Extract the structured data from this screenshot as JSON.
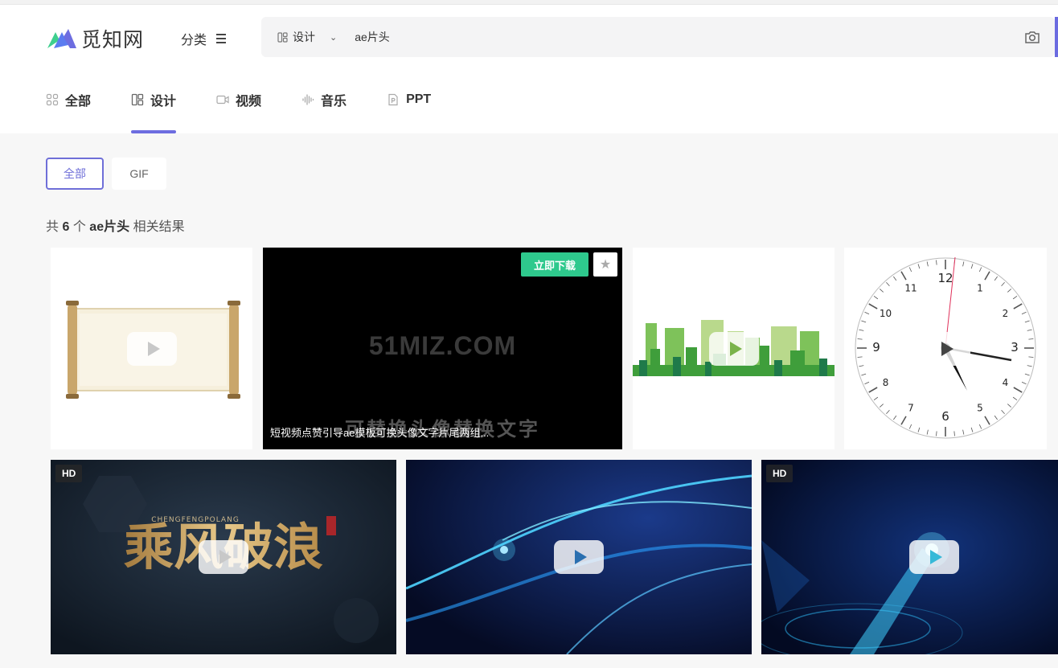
{
  "brand": {
    "name": "觅知网",
    "accent": "#6d6de0",
    "green": "#2ec98d"
  },
  "header": {
    "category_label": "分类"
  },
  "search": {
    "type_label": "设计",
    "query": "ae片头",
    "placeholder": ""
  },
  "tabs": [
    {
      "label": "全部",
      "icon": "grid-icon"
    },
    {
      "label": "设计",
      "icon": "layout-icon",
      "active": true
    },
    {
      "label": "视频",
      "icon": "video-icon"
    },
    {
      "label": "音乐",
      "icon": "audio-wave-icon"
    },
    {
      "label": "PPT",
      "icon": "ppt-file-icon"
    }
  ],
  "filters": [
    {
      "label": "全部",
      "active": true
    },
    {
      "label": "GIF"
    }
  ],
  "results": {
    "prefix": "共",
    "count": "6",
    "measure": "个",
    "keyword": "ae片头",
    "suffix": "相关结果"
  },
  "cards": [
    {
      "id": "scroll"
    },
    {
      "id": "51miz",
      "watermark": "51MIZ.COM",
      "overlay_text": "可替换头像替换文字",
      "title": "短视频点赞引导ae模板可换头像文字片尾两组...",
      "download_label": "立即下载"
    },
    {
      "id": "city"
    },
    {
      "id": "clock",
      "numbers": [
        "12",
        "1",
        "2",
        "3",
        "4",
        "5",
        "6",
        "7",
        "8",
        "9",
        "10",
        "11"
      ]
    },
    {
      "id": "chengfeng",
      "badge": "HD",
      "art_title": "乘风破浪",
      "art_subtitle": "CHENGFENGPOLANG"
    },
    {
      "id": "light-streaks"
    },
    {
      "id": "blue-beam",
      "badge": "HD"
    }
  ]
}
